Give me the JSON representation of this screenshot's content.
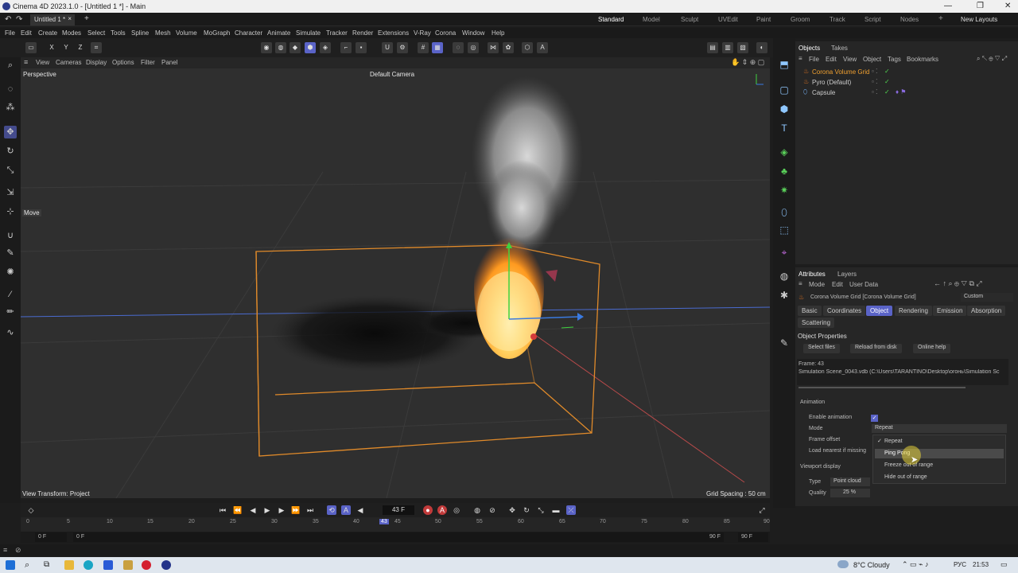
{
  "window": {
    "title": "Cinema 4D 2023.1.0 - [Untitled 1 *] - Main",
    "min": "—",
    "max": "❐",
    "close": "✕"
  },
  "doc_tab": {
    "label": "Untitled 1 *",
    "close": "×",
    "add": "+"
  },
  "layouts": {
    "items": [
      "Standard",
      "Model",
      "Sculpt",
      "UVEdit",
      "Paint",
      "Groom",
      "Track",
      "Script",
      "Nodes"
    ],
    "add": "+",
    "new_layouts": "New Layouts"
  },
  "menu": [
    "File",
    "Edit",
    "Create",
    "Modes",
    "Select",
    "Tools",
    "Spline",
    "Mesh",
    "Volume",
    "MoGraph",
    "Character",
    "Animate",
    "Simulate",
    "Tracker",
    "Render",
    "Extensions",
    "V-Ray",
    "Corona",
    "Window",
    "Help"
  ],
  "toolbar": {
    "axes": [
      "X",
      "Y",
      "Z"
    ]
  },
  "viewport_menu": [
    "View",
    "Cameras",
    "Display",
    "Options",
    "Filter",
    "Panel"
  ],
  "viewport": {
    "name": "Perspective",
    "camera": "Default Camera",
    "move_label": "Move",
    "view_transform": "View Transform: Project",
    "grid_spacing": "Grid Spacing : 50 cm"
  },
  "playback": {
    "current_frame": "43 F"
  },
  "ruler": {
    "ticks": [
      "0",
      "5",
      "10",
      "15",
      "20",
      "25",
      "30",
      "35",
      "40",
      "45",
      "50",
      "55",
      "60",
      "65",
      "70",
      "75",
      "80",
      "85",
      "90"
    ],
    "marker": "43"
  },
  "frames": {
    "start": "0 F",
    "min": "0 F",
    "max": "90 F",
    "end": "90 F"
  },
  "objects": {
    "tabs": [
      "Objects",
      "Takes"
    ],
    "menu": [
      "File",
      "Edit",
      "View",
      "Object",
      "Tags",
      "Bookmarks"
    ],
    "rows": [
      {
        "name": "Corona Volume Grid",
        "color": "#f0a030"
      },
      {
        "name": "Pyro (Default)",
        "color": "#cccccc"
      },
      {
        "name": "Capsule",
        "color": "#cccccc"
      }
    ]
  },
  "attributes": {
    "tabs": [
      "Attributes",
      "Layers"
    ],
    "menu": [
      "Mode",
      "Edit",
      "User Data"
    ],
    "object_title": "Corona Volume Grid [Corona Volume Grid]",
    "preset": "Custom",
    "sub_tabs": [
      "Basic",
      "Coordinates",
      "Object",
      "Rendering",
      "Emission",
      "Absorption",
      "Scattering"
    ],
    "section": "Object Properties",
    "buttons": [
      "Select files",
      "Reload from disk",
      "Online help"
    ],
    "frame_info": "Frame: 43",
    "file_info": "Simulation Scene_0043.vdb (C:\\Users\\TARANTINO\\Desktop\\огонь\\Simulation Sc",
    "animation_header": "Animation",
    "enable_animation_label": "Enable animation",
    "mode_label": "Mode",
    "mode_value": "Repeat",
    "frame_offset_label": "Frame offset",
    "load_nearest_label": "Load nearest if missing",
    "dropdown_options": [
      "Repeat",
      "Ping Pong",
      "Freeze out of range",
      "Hide out of range"
    ],
    "viewport_display_header": "Viewport display",
    "type_label": "Type",
    "type_value": "Point cloud",
    "quality_label": "Quality",
    "quality_value": "25 %"
  },
  "taskbar": {
    "weather": "8°C Cloudy",
    "lang": "РУС",
    "time": "21:53"
  },
  "colors": {
    "accent": "#5a63c7",
    "selection": "#e08a2a",
    "fire": "#ffb030"
  }
}
